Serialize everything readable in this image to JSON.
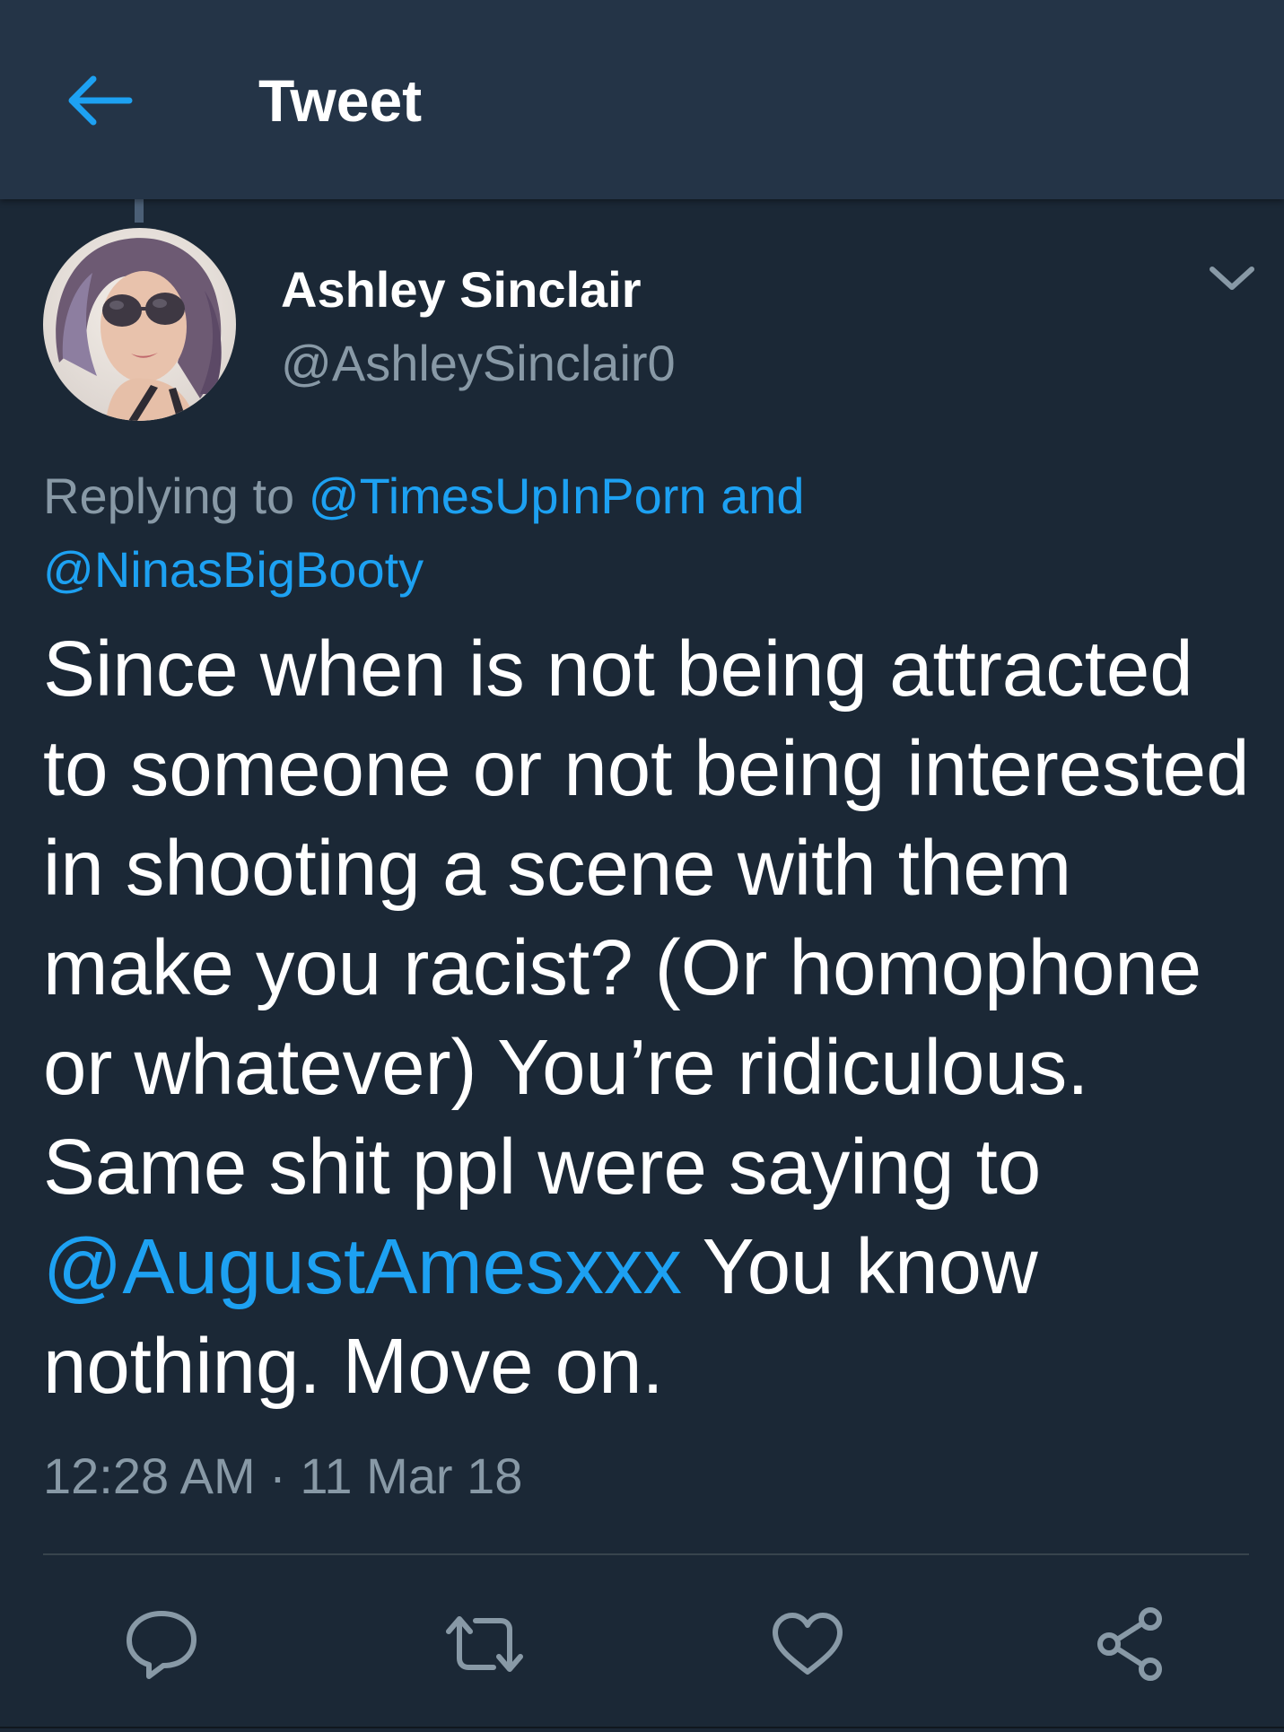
{
  "header": {
    "title": "Tweet",
    "back_icon": "arrow-left-icon"
  },
  "tweet": {
    "author": {
      "name": "Ashley Sinclair",
      "handle": "@AshleySinclair0"
    },
    "replying": {
      "prefix": "Replying to",
      "first_handle": "@TimesUpInPorn",
      "joiner": "and",
      "second_handle": "@NinasBigBooty"
    },
    "text": {
      "part1": "Since when is not being attracted to someone or not being interested in shooting a scene with them make you racist? (Or homophone or whatever) You’re ridiculous. Same shit ppl were saying to ",
      "mention": "@AugustAmesxxx",
      "part2": " You know nothing. Move on."
    },
    "timestamp": "12:28 AM · 11 Mar 18"
  },
  "actions": {
    "icons": [
      "reply-icon",
      "retweet-icon",
      "like-icon",
      "share-icon"
    ]
  },
  "colors": {
    "background": "#1b2836",
    "header": "#243447",
    "accent": "#1da1f2",
    "secondary_text": "#8899a6",
    "primary_text": "#ffffff"
  }
}
